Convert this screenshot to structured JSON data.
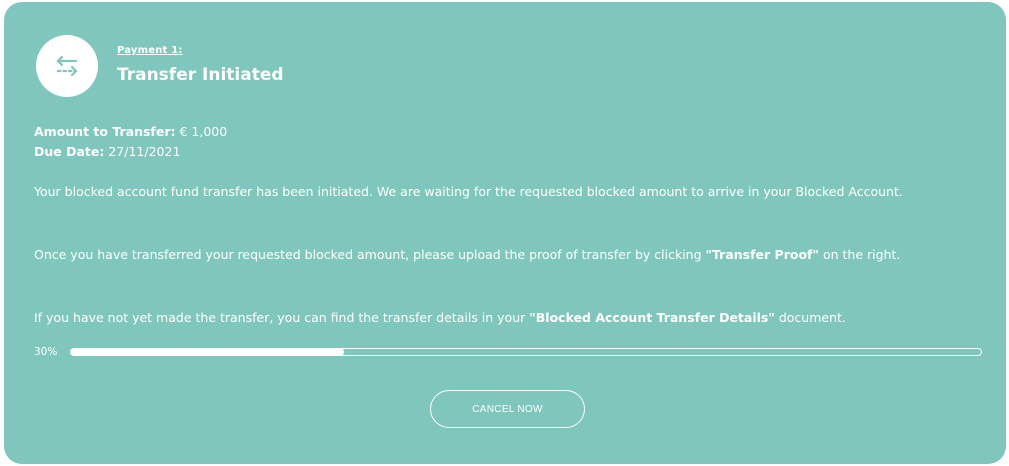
{
  "header": {
    "payment_label": "Payment 1:",
    "title": "Transfer Initiated",
    "icon": "transfer-arrows-icon"
  },
  "facts": {
    "amount_label": "Amount to Transfer:",
    "amount_value": "€ 1,000",
    "due_label": "Due Date:",
    "due_value": "27/11/2021"
  },
  "paragraphs": {
    "p1": "Your blocked account fund transfer has been initiated. We are waiting for the requested blocked amount to arrive in your Blocked Account.",
    "p2_before": "Once you have transferred your requested blocked amount, please upload the proof of transfer by clicking ",
    "p2_bold": "\"Transfer Proof\"",
    "p2_after": " on the right.",
    "p3_before": "If you have not yet made the transfer, you can find the transfer details in your ",
    "p3_bold": "\"Blocked Account Transfer Details\"",
    "p3_after": " document."
  },
  "progress": {
    "label": "30%",
    "value": 0.3
  },
  "actions": {
    "cancel_label": "CANCEL NOW"
  },
  "colors": {
    "card_background": "#7fc6bd",
    "accent": "#7fc6bd",
    "text": "#ffffff"
  }
}
